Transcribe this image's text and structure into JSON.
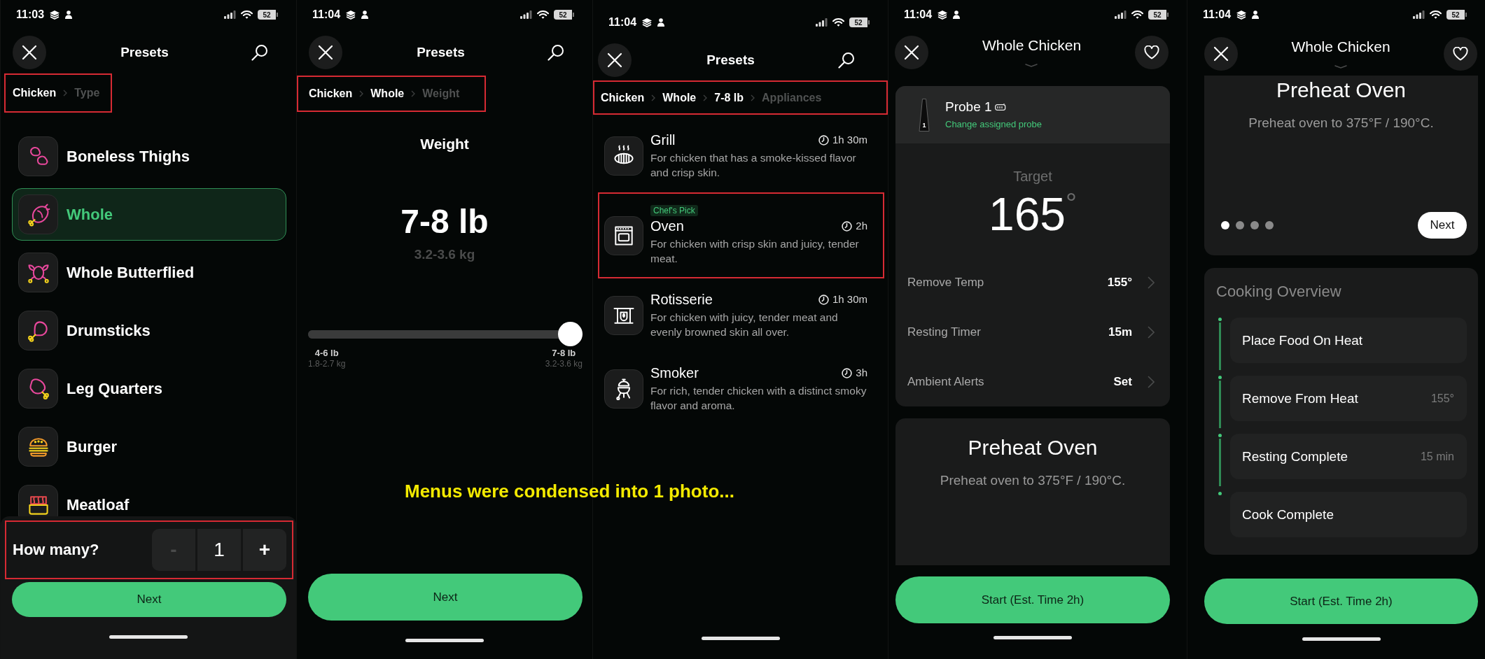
{
  "caption": "Menus were condensed into 1 photo...",
  "screens": [
    {
      "kind": "type_list",
      "status_bar": {
        "time": "11:03",
        "battery": "52"
      },
      "header": {
        "title": "Presets"
      },
      "breadcrumb": {
        "highlighted": true,
        "items": [
          {
            "label": "Chicken",
            "current": false
          },
          {
            "label": "Type",
            "current": true
          }
        ]
      },
      "items": [
        {
          "label": "Boneless Thighs",
          "selected": false
        },
        {
          "label": "Whole",
          "selected": true
        },
        {
          "label": "Whole Butterflied",
          "selected": false
        },
        {
          "label": "Drumsticks",
          "selected": false
        },
        {
          "label": "Leg Quarters",
          "selected": false
        },
        {
          "label": "Burger",
          "selected": false
        },
        {
          "label": "Meatloaf",
          "selected": false
        }
      ],
      "quantity": {
        "highlighted": true,
        "label": "How many?",
        "value": "1",
        "decrement": {
          "symbol": "-",
          "disabled": true
        },
        "increment": {
          "symbol": "+",
          "disabled": false
        }
      },
      "next_button": "Next"
    },
    {
      "kind": "weight",
      "status_bar": {
        "time": "11:04",
        "battery": "52"
      },
      "header": {
        "title": "Presets"
      },
      "breadcrumb": {
        "highlighted": true,
        "items": [
          {
            "label": "Chicken",
            "current": false
          },
          {
            "label": "Whole",
            "current": false
          },
          {
            "label": "Weight",
            "current": true
          }
        ]
      },
      "heading": "Weight",
      "value": "7-8 lb",
      "value_metric": "3.2-3.6 kg",
      "slider": {
        "level": 1,
        "min_label": "4-6 lb",
        "min_metric": "1.8-2.7 kg",
        "max_label": "7-8 lb",
        "max_metric": "3.2-3.6 kg"
      },
      "next_button": "Next"
    },
    {
      "kind": "appliances",
      "status_bar": {
        "time": "11:04",
        "battery": "52"
      },
      "header": {
        "title": "Presets"
      },
      "breadcrumb": {
        "highlighted": true,
        "items": [
          {
            "label": "Chicken",
            "current": false
          },
          {
            "label": "Whole",
            "current": false
          },
          {
            "label": "7-8 lb",
            "current": false
          },
          {
            "label": "Appliances",
            "current": true
          }
        ]
      },
      "appliances": [
        {
          "name": "Grill",
          "time": "1h 30m",
          "description": "For chicken that has a smoke-kissed flavor and crisp skin.",
          "highlighted": false
        },
        {
          "badge": "Chef's Pick",
          "name": "Oven",
          "time": "2h",
          "description": "For chicken with crisp skin and juicy, tender meat.",
          "highlighted": true
        },
        {
          "name": "Rotisserie",
          "time": "1h 30m",
          "description": "For chicken with juicy, tender meat and evenly browned skin all over.",
          "highlighted": false
        },
        {
          "name": "Smoker",
          "time": "3h",
          "description": "For rich, tender chicken with a distinct smoky flavor and aroma.",
          "highlighted": false
        }
      ]
    },
    {
      "kind": "probe_setup",
      "status_bar": {
        "time": "11:04",
        "battery": "52"
      },
      "header": {
        "title": "Whole Chicken"
      },
      "probe": {
        "name": "Probe 1",
        "number": "1",
        "link": "Change assigned probe"
      },
      "target": {
        "label": "Target",
        "value": "165",
        "unit": "°"
      },
      "settings": [
        {
          "label": "Remove Temp",
          "value": "155°"
        },
        {
          "label": "Resting Timer",
          "value": "15m"
        },
        {
          "label": "Ambient Alerts",
          "value": "Set"
        }
      ],
      "step": {
        "title": "Preheat Oven",
        "text": "Preheat oven to 375°F / 190°C."
      },
      "start_button": "Start (Est. Time 2h)"
    },
    {
      "kind": "overview",
      "status_bar": {
        "time": "11:04",
        "battery": "52"
      },
      "header": {
        "title": "Whole Chicken"
      },
      "step": {
        "title": "Preheat Oven",
        "text": "Preheat oven to 375°F / 190°C.",
        "pages": [
          {
            "selected": true
          },
          {
            "selected": false
          },
          {
            "selected": false
          },
          {
            "selected": false
          }
        ],
        "next_button": "Next"
      },
      "overview": {
        "title": "Cooking Overview",
        "steps": [
          {
            "label": "Place Food On Heat"
          },
          {
            "label": "Remove From Heat",
            "detail": "155°"
          },
          {
            "label": "Resting Complete",
            "detail": "15 min"
          },
          {
            "label": "Cook Complete"
          }
        ]
      },
      "start_button": "Start (Est. Time 2h)"
    }
  ]
}
